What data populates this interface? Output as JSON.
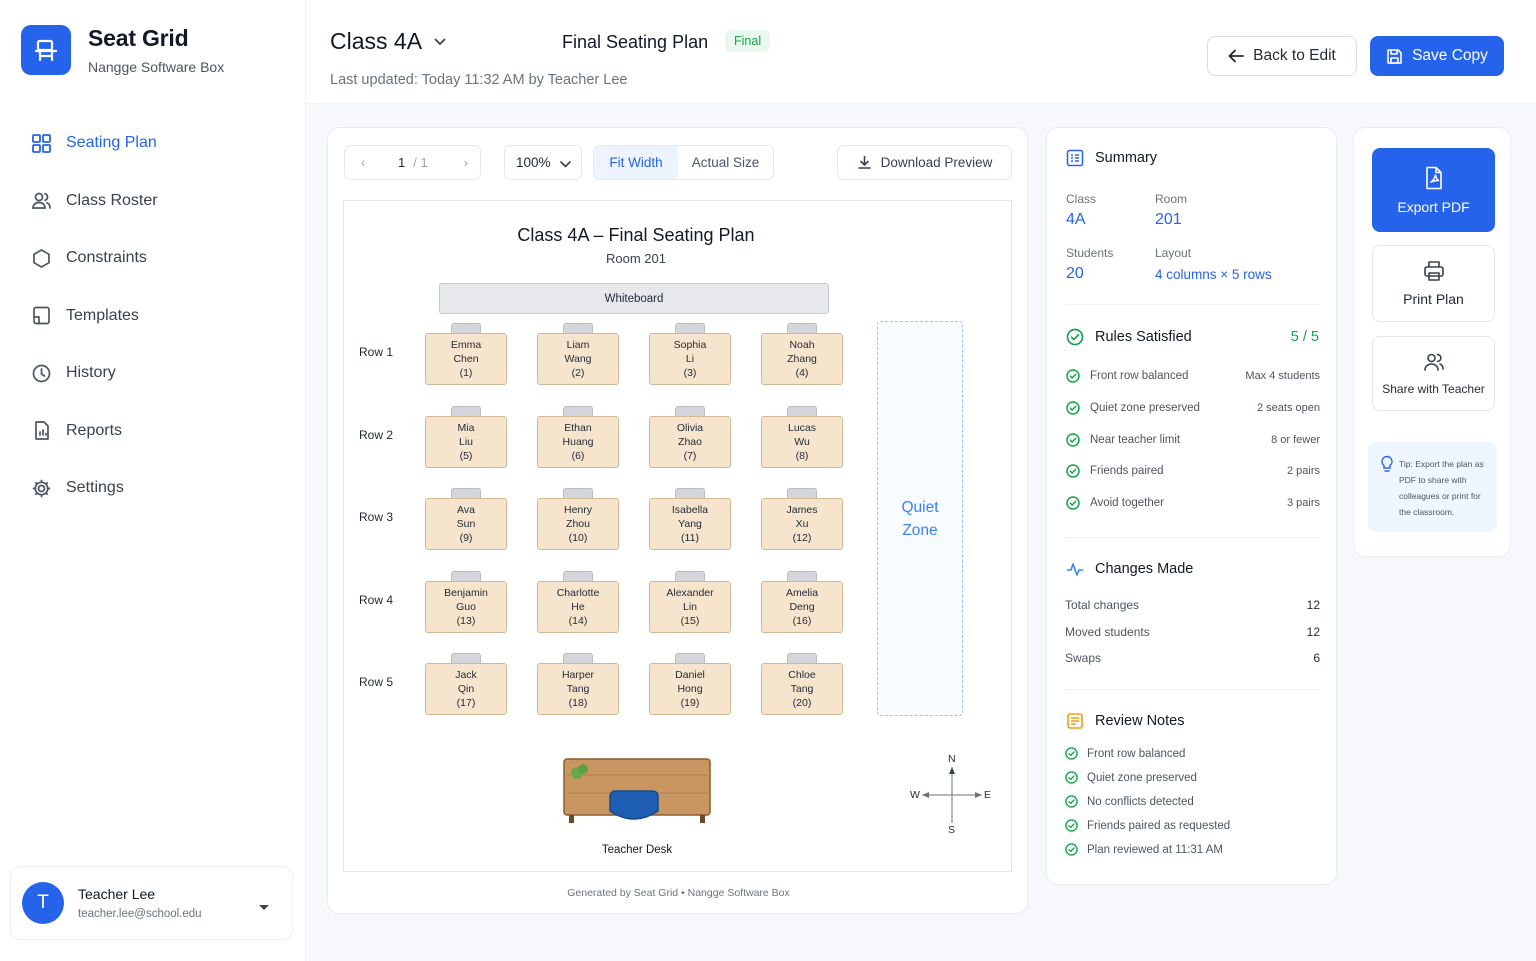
{
  "app": {
    "name": "Seat Grid",
    "subtitle": "Nangge Software Box"
  },
  "sidebar": {
    "items": [
      {
        "label": "Seating Plan",
        "icon": "grid-icon",
        "active": true
      },
      {
        "label": "Class Roster",
        "icon": "users-icon"
      },
      {
        "label": "Constraints",
        "icon": "hexagon-icon"
      },
      {
        "label": "Templates",
        "icon": "template-icon"
      },
      {
        "label": "History",
        "icon": "clock-icon"
      },
      {
        "label": "Reports",
        "icon": "report-icon"
      },
      {
        "label": "Settings",
        "icon": "gear-icon"
      }
    ]
  },
  "user": {
    "initial": "T",
    "name": "Teacher Lee",
    "email": "teacher.lee@school.edu"
  },
  "header": {
    "class_name": "Class 4A",
    "plan_title": "Final Seating Plan",
    "badge": "Final",
    "last_updated": "Last updated: Today 11:32 AM by Teacher Lee",
    "back_label": "Back to Edit",
    "save_label": "Save Copy"
  },
  "preview": {
    "page_current": "1",
    "page_total": "/ 1",
    "zoom": "100%",
    "fit_width": "Fit Width",
    "actual_size": "Actual Size",
    "download": "Download Preview",
    "footer": "Generated by Seat Grid  •  Nangge Software Box"
  },
  "sheet": {
    "title": "Class 4A – Final Seating Plan",
    "room": "Room 201",
    "whiteboard": "Whiteboard",
    "quiet_zone": "Quiet Zone",
    "teacher_desk": "Teacher Desk",
    "compass": {
      "n": "N",
      "s": "S",
      "w": "W",
      "e": "E"
    },
    "rows": [
      {
        "label": "Row 1",
        "seats": [
          {
            "first": "Emma",
            "last": "Chen",
            "num": "(1)"
          },
          {
            "first": "Liam",
            "last": "Wang",
            "num": "(2)"
          },
          {
            "first": "Sophia",
            "last": "Li",
            "num": "(3)"
          },
          {
            "first": "Noah",
            "last": "Zhang",
            "num": "(4)"
          }
        ]
      },
      {
        "label": "Row 2",
        "seats": [
          {
            "first": "Mia",
            "last": "Liu",
            "num": "(5)"
          },
          {
            "first": "Ethan",
            "last": "Huang",
            "num": "(6)"
          },
          {
            "first": "Olivia",
            "last": "Zhao",
            "num": "(7)"
          },
          {
            "first": "Lucas",
            "last": "Wu",
            "num": "(8)"
          }
        ]
      },
      {
        "label": "Row 3",
        "seats": [
          {
            "first": "Ava",
            "last": "Sun",
            "num": "(9)"
          },
          {
            "first": "Henry",
            "last": "Zhou",
            "num": "(10)"
          },
          {
            "first": "Isabella",
            "last": "Yang",
            "num": "(11)"
          },
          {
            "first": "James",
            "last": "Xu",
            "num": "(12)"
          }
        ]
      },
      {
        "label": "Row 4",
        "seats": [
          {
            "first": "Benjamin",
            "last": "Guo",
            "num": "(13)"
          },
          {
            "first": "Charlotte",
            "last": "He",
            "num": "(14)"
          },
          {
            "first": "Alexander",
            "last": "Lin",
            "num": "(15)"
          },
          {
            "first": "Amelia",
            "last": "Deng",
            "num": "(16)"
          }
        ]
      },
      {
        "label": "Row 5",
        "seats": [
          {
            "first": "Jack",
            "last": "Qin",
            "num": "(17)"
          },
          {
            "first": "Harper",
            "last": "Tang",
            "num": "(18)"
          },
          {
            "first": "Daniel",
            "last": "Hong",
            "num": "(19)"
          },
          {
            "first": "Chloe",
            "last": "Tang",
            "num": "(20)"
          }
        ]
      }
    ]
  },
  "summary": {
    "title": "Summary",
    "class_label": "Class",
    "class_value": "4A",
    "room_label": "Room",
    "room_value": "201",
    "students_label": "Students",
    "students_value": "20",
    "layout_label": "Layout",
    "layout_value": "4 columns × 5 rows",
    "rules_title": "Rules Satisfied",
    "rules_score": "5 / 5",
    "rules": [
      {
        "label": "Front row balanced",
        "value": "Max 4 students"
      },
      {
        "label": "Quiet zone preserved",
        "value": "2 seats open"
      },
      {
        "label": "Near teacher limit",
        "value": "8 or fewer"
      },
      {
        "label": "Friends paired",
        "value": "2 pairs"
      },
      {
        "label": "Avoid together",
        "value": "3 pairs"
      }
    ],
    "changes_title": "Changes Made",
    "changes": [
      {
        "label": "Total changes",
        "value": "12"
      },
      {
        "label": "Moved students",
        "value": "12"
      },
      {
        "label": "Swaps",
        "value": "6"
      }
    ],
    "notes_title": "Review Notes",
    "notes": [
      "Front row balanced",
      "Quiet zone preserved",
      "No conflicts detected",
      "Friends paired as requested",
      "Plan reviewed at 11:31 AM"
    ]
  },
  "actions": {
    "export_pdf": "Export PDF",
    "print_plan": "Print Plan",
    "share": "Share with Teacher",
    "tip": "Tip: Export the plan as PDF to share with colleagues or print for the classroom."
  },
  "colors": {
    "accent": "#2563eb",
    "success": "#16a34a",
    "desk": "#f6e5cc",
    "quiet_zone": "#3b82f6"
  }
}
